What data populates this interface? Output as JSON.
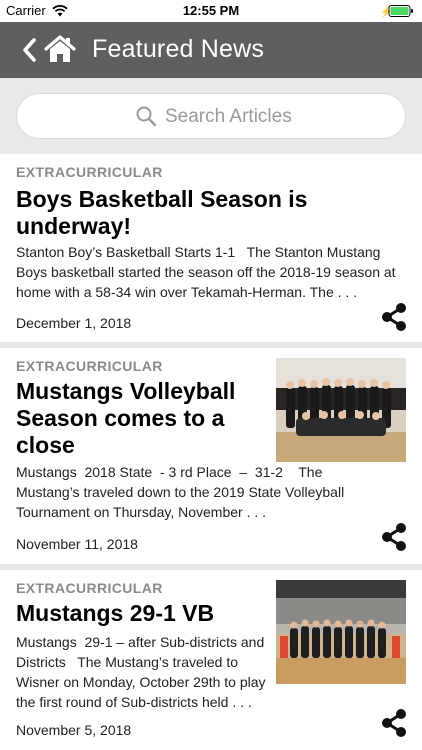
{
  "status_bar": {
    "carrier": "Carrier",
    "time": "12:55 PM"
  },
  "nav": {
    "title": "Featured News",
    "back_icon": "chevron-left-icon",
    "home_icon": "home-icon"
  },
  "search": {
    "placeholder": "Search Articles"
  },
  "articles": [
    {
      "category": "EXTRACURRICULAR",
      "title": "Boys Basketball Season is underway!",
      "summary": "Stanton Boy’s Basketball Starts 1-1   The Stanton Mustang Boys basketball started the season off the 2018-19 season at home with a 58-34 win over Tekamah-Herman. The . . .",
      "date": "December 1, 2018"
    },
    {
      "category": "EXTRACURRICULAR",
      "title": "Mustangs Volleyball Season comes to a close",
      "summary": "Mustangs  2018 State  - 3 rd Place  –  31-2    The Mustang’s traveled down to the 2019 State Volleyball Tournament on Thursday, November . . .",
      "date": "November 11, 2018"
    },
    {
      "category": "EXTRACURRICULAR",
      "title": "Mustangs 29-1 VB",
      "summary": "Mustangs  29-1 – after Sub-districts and Districts   The Mustang’s traveled to Wisner on Monday, October 29th to play the first round of Sub-districts held . . .",
      "date": "November 5, 2018"
    }
  ],
  "colors": {
    "nav_bg": "#5f5f5f",
    "search_bg": "#e9e9e9",
    "category": "#8a8a8a",
    "separator": "#e5e5e5"
  }
}
